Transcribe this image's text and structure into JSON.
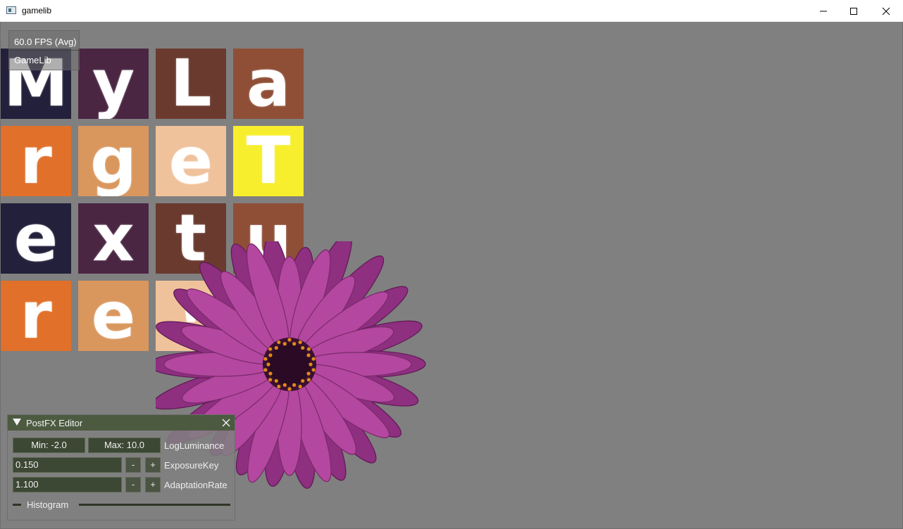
{
  "window": {
    "title": "gamelib",
    "controls": {
      "minimize_icon": "minimize-icon",
      "maximize_icon": "maximize-icon",
      "close_icon": "close-icon"
    }
  },
  "overlay": {
    "fps": "60.0 FPS (Avg)",
    "app_name": "GameLib"
  },
  "tiles": [
    {
      "letter": "M",
      "color": "#22203a"
    },
    {
      "letter": "y",
      "color": "#4a2643"
    },
    {
      "letter": "L",
      "color": "#6b3a2f"
    },
    {
      "letter": "a",
      "color": "#8f4f37"
    },
    {
      "letter": "r",
      "color": "#e0702a"
    },
    {
      "letter": "g",
      "color": "#d9975e"
    },
    {
      "letter": "e",
      "color": "#f0c29b"
    },
    {
      "letter": "T",
      "color": "#f7ee2e"
    },
    {
      "letter": "e",
      "color": "#22203a"
    },
    {
      "letter": "x",
      "color": "#4a2643"
    },
    {
      "letter": "t",
      "color": "#6b3a2f"
    },
    {
      "letter": "u",
      "color": "#8f4f37"
    },
    {
      "letter": "r",
      "color": "#e0702a"
    },
    {
      "letter": "e",
      "color": "#d9975e"
    },
    {
      "letter": "!",
      "color": "#f0c29b"
    }
  ],
  "postfx": {
    "title": "PostFX Editor",
    "log_luminance": {
      "min": "Min: -2.0",
      "max": "Max: 10.0",
      "label": "LogLuminance"
    },
    "exposure_key": {
      "value": "0.150",
      "minus": "-",
      "plus": "+",
      "label": "ExposureKey"
    },
    "adaptation_rate": {
      "value": "1.100",
      "minus": "-",
      "plus": "+",
      "label": "AdaptationRate"
    },
    "histogram": {
      "label": "Histogram"
    }
  },
  "colors": {
    "background": "#808080",
    "panel_header": "#4c5a40",
    "field_bg": "#3c4734"
  }
}
